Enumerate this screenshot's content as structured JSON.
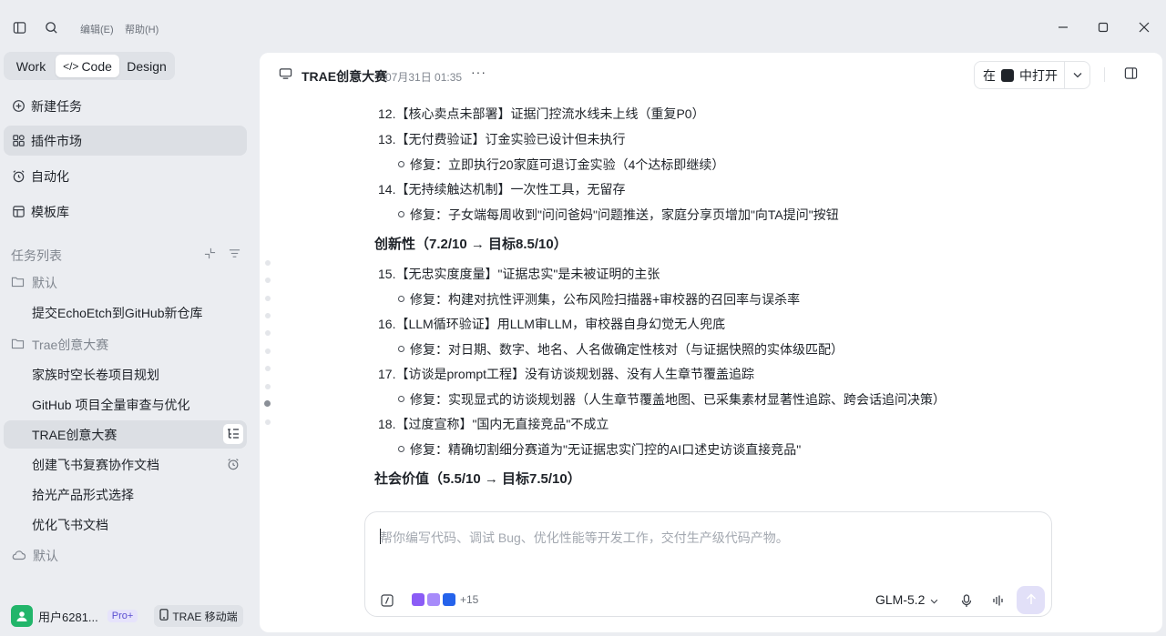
{
  "titlebar": {
    "menu_edit": "编辑(E)",
    "menu_help": "帮助(H)"
  },
  "sidebar": {
    "modes": [
      "Work",
      "Code",
      "Design"
    ],
    "active_mode": "Code",
    "nav": [
      {
        "label": "新建任务",
        "icon": "plus-circle-icon"
      },
      {
        "label": "插件市场",
        "icon": "plugin-grid-icon"
      },
      {
        "label": "自动化",
        "icon": "alarm-clock-icon"
      },
      {
        "label": "模板库",
        "icon": "template-icon"
      }
    ],
    "section_title": "任务列表",
    "groups": [
      {
        "label": "默认",
        "tasks": [
          "提交EchoEtch到GitHub新仓库"
        ]
      },
      {
        "label": "Trae创意大赛",
        "tasks": [
          "家族时空长卷项目规划",
          "GitHub 项目全量审查与优化",
          "TRAE创意大赛",
          "创建飞书复赛协作文档",
          "拾光产品形式选择",
          "优化飞书文档"
        ]
      }
    ],
    "cloud_group": "默认",
    "user": {
      "name": "用户6281...",
      "badge": "Pro+"
    },
    "mobile_button": "TRAE 移动端"
  },
  "header": {
    "title": "TRAE创意大赛",
    "date": "07月31日 01:35",
    "more": "···",
    "open_prefix": "在",
    "open_suffix": "中打开"
  },
  "content": {
    "lines": [
      {
        "kind": "num",
        "text": "12.【核心卖点未部署】证据门控流水线未上线（重复P0）"
      },
      {
        "kind": "num",
        "text": "13.【无付费验证】订金实验已设计但未执行"
      },
      {
        "kind": "sub",
        "text": "修复：立即执行20家庭可退订金实验（4个达标即继续）"
      },
      {
        "kind": "num",
        "text": "14.【无持续触达机制】一次性工具，无留存"
      },
      {
        "kind": "sub",
        "text": "修复：子女端每周收到\"问问爸妈\"问题推送，家庭分享页增加\"向TA提问\"按钮"
      },
      {
        "kind": "head",
        "text": "创新性（7.2/10 → 目标8.5/10）"
      },
      {
        "kind": "num",
        "text": "15.【无忠实度度量】\"证据忠实\"是未被证明的主张"
      },
      {
        "kind": "sub",
        "text": "修复：构建对抗性评测集，公布风险扫描器+审校器的召回率与误杀率"
      },
      {
        "kind": "num",
        "text": "16.【LLM循环验证】用LLM审LLM，审校器自身幻觉无人兜底"
      },
      {
        "kind": "sub",
        "text": "修复：对日期、数字、地名、人名做确定性核对（与证据快照的实体级匹配）"
      },
      {
        "kind": "num",
        "text": "17.【访谈是prompt工程】没有访谈规划器、没有人生章节覆盖追踪"
      },
      {
        "kind": "sub",
        "text": "修复：实现显式的访谈规划器（人生章节覆盖地图、已采集素材显著性追踪、跨会话追问决策）"
      },
      {
        "kind": "num",
        "text": "18.【过度宣称】\"国内无直接竞品\"不成立"
      },
      {
        "kind": "sub",
        "text": "修复：精确切割细分赛道为\"无证据忠实门控的AI口述史访谈直接竞品\""
      },
      {
        "kind": "head",
        "text": "社会价值（5.5/10 → 目标7.5/10）"
      }
    ]
  },
  "input": {
    "placeholder": "帮你编写代码、调试 Bug、优化性能等开发工作，交付生产级代码产物。",
    "apps_more": "+15",
    "model": "GLM-5.2"
  }
}
